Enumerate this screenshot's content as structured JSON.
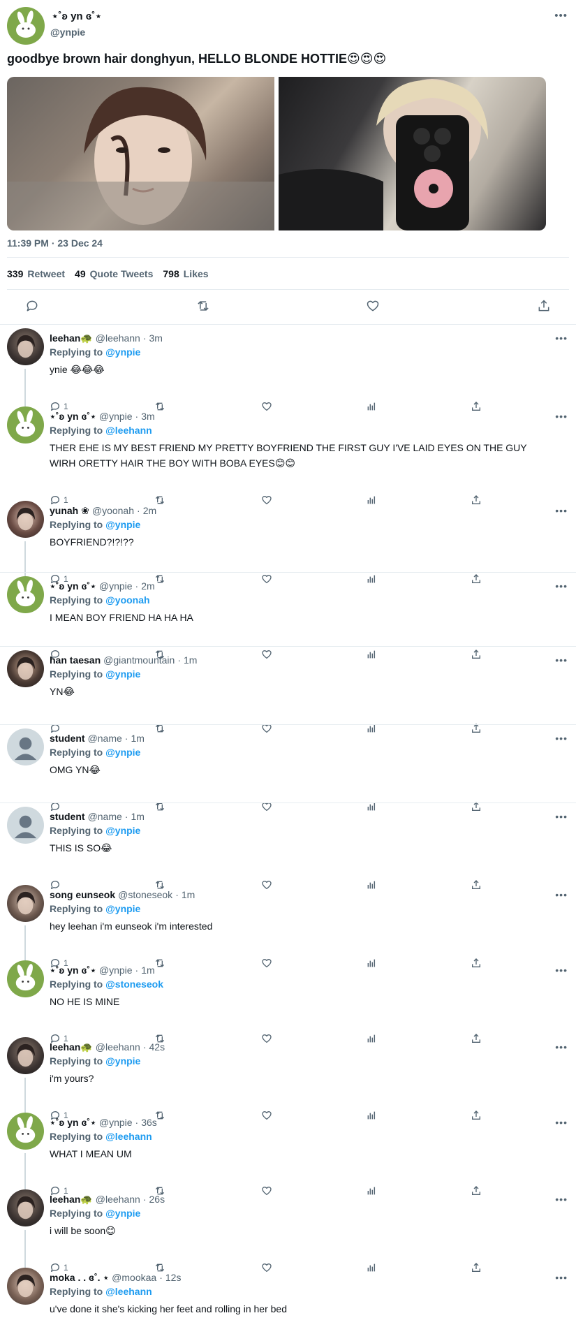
{
  "main": {
    "name": "⋆˚ʚ yn ɞ˚⋆",
    "handle": "@ynpie",
    "text": "goodbye brown hair donghyun, HELLO BLONDE HOTTIE😍😍😍",
    "time": "11:39 PM · 23 Dec 24",
    "retweets": "339",
    "retweets_label": "Retweet",
    "quotes": "49",
    "quotes_label": "Quote Tweets",
    "likes": "798",
    "likes_label": "Likes"
  },
  "replies": [
    {
      "name": "leehan🐢",
      "handle": "@leehann",
      "time": "3m",
      "replying_label": "Replying to",
      "replying_to": "@ynpie",
      "text": "ynie 😂😂😂",
      "reply_count": "1",
      "avatar": "leehan"
    },
    {
      "name": "⋆˚ʚ yn ɞ˚⋆",
      "handle": "@ynpie",
      "time": "3m",
      "replying_label": "Replying to",
      "replying_to": "@leehann",
      "text": "THER EHE IS MY BEST FRIEND MY PRETTY BOYFRIEND THE FIRST GUY I'VE LAID EYES ON THE GUY WIRH ORETTY HAIR THE BOY WITH BOBA EYES😊😊",
      "reply_count": "1",
      "avatar": "yn"
    },
    {
      "name": "yunah ❀",
      "handle": "@yoonah",
      "time": "2m",
      "replying_label": "Replying to",
      "replying_to": "@ynpie",
      "text": "BOYFRIEND?!?!??",
      "reply_count": "1",
      "avatar": "yunah"
    },
    {
      "name": "⋆˚ʚ yn ɞ˚⋆",
      "handle": "@ynpie",
      "time": "2m",
      "replying_label": "Replying to",
      "replying_to": "@yoonah",
      "text": "I MEAN BOY FRIEND HA HA HA",
      "reply_count": "",
      "avatar": "yn"
    },
    {
      "name": "han taesan",
      "handle": "@giantmountain",
      "time": "1m",
      "replying_label": "Replying to",
      "replying_to": "@ynpie",
      "text": "YN😂",
      "reply_count": "",
      "avatar": "han"
    },
    {
      "name": "student",
      "handle": "@name",
      "time": "1m",
      "replying_label": "Replying to",
      "replying_to": "@ynpie",
      "text": "OMG YN😂",
      "reply_count": "",
      "avatar": "default"
    },
    {
      "name": "student",
      "handle": "@name",
      "time": "1m",
      "replying_label": "Replying to",
      "replying_to": "@ynpie",
      "text": "THIS IS SO😂",
      "reply_count": "",
      "avatar": "default"
    },
    {
      "name": "song eunseok",
      "handle": "@stoneseok",
      "time": "1m",
      "replying_label": "Replying to",
      "replying_to": "@ynpie",
      "text": "hey leehan i'm eunseok i'm interested",
      "reply_count": "1",
      "avatar": "song"
    },
    {
      "name": "⋆˚ʚ yn ɞ˚⋆",
      "handle": "@ynpie",
      "time": "1m",
      "replying_label": "Replying to",
      "replying_to": "@stoneseok",
      "text": "NO HE IS MINE",
      "reply_count": "1",
      "avatar": "yn"
    },
    {
      "name": "leehan🐢",
      "handle": "@leehann",
      "time": "42s",
      "replying_label": "Replying to",
      "replying_to": "@ynpie",
      "text": "i'm yours?",
      "reply_count": "1",
      "avatar": "leehan"
    },
    {
      "name": "⋆˚ʚ yn ɞ˚⋆",
      "handle": "@ynpie",
      "time": "36s",
      "replying_label": "Replying to",
      "replying_to": "@leehann",
      "text": "WHAT I MEAN UM",
      "reply_count": "1",
      "avatar": "yn"
    },
    {
      "name": "leehan🐢",
      "handle": "@leehann",
      "time": "26s",
      "replying_label": "Replying to",
      "replying_to": "@ynpie",
      "text": "i will be soon😊",
      "reply_count": "1",
      "avatar": "leehan"
    },
    {
      "name": "moka . . ɞ˚. ⋆",
      "handle": "@mookaa",
      "time": "12s",
      "replying_label": "Replying to",
      "replying_to": "@leehann",
      "text": "u've done it she's kicking her feet and rolling in her bed",
      "reply_count": "",
      "avatar": "moka"
    }
  ],
  "colors": {
    "accent": "#1d9bf0",
    "muted": "#536471",
    "divider": "#e6ecf0",
    "avatar_green": "#7fa84a"
  }
}
